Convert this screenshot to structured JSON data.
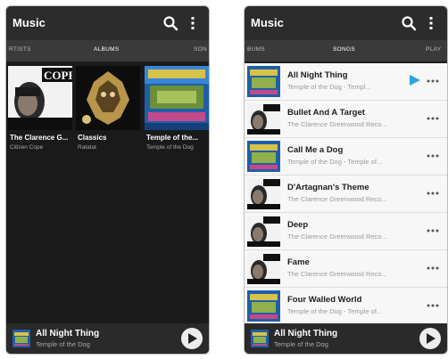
{
  "left": {
    "app_title": "Music",
    "tabs": [
      "RTISTS",
      "ALBUMS",
      "SON"
    ],
    "albums": [
      {
        "title": "The Clarence G...",
        "artist": "Citizen Cope",
        "cover_text": "COPE"
      },
      {
        "title": "Classics",
        "artist": "Ratatat"
      },
      {
        "title": "Temple of the...",
        "artist": "Temple of the Dog"
      }
    ],
    "now_playing": {
      "title": "All Night Thing",
      "artist": "Temple of the Dog"
    }
  },
  "right": {
    "app_title": "Music",
    "tabs": [
      "BUMS",
      "SONGS",
      "PLAY"
    ],
    "songs": [
      {
        "title": "All Night Thing",
        "subtitle": "Temple of the Dog - Templ..."
      },
      {
        "title": "Bullet And A Target",
        "subtitle": "The Clarence Greenwood Reco..."
      },
      {
        "title": "Call Me a Dog",
        "subtitle": "Temple of the Dog - Temple of..."
      },
      {
        "title": "D'Artagnan's Theme",
        "subtitle": "The Clarence Greenwood Reco..."
      },
      {
        "title": "Deep",
        "subtitle": "The Clarence Greenwood Reco..."
      },
      {
        "title": "Fame",
        "subtitle": "The Clarence Greenwood Reco..."
      },
      {
        "title": "Four Walled World",
        "subtitle": "Temple of the Dog - Temple of..."
      }
    ],
    "now_playing": {
      "title": "All Night Thing",
      "artist": "Temple of the Dog"
    }
  },
  "icons": {
    "search": "search-icon",
    "menu": "overflow-menu-icon",
    "play": "play-icon",
    "more": "more-options-icon",
    "now_playing": "playing-indicator-icon"
  },
  "colors": {
    "accent": "#2aa3e0",
    "dark_bg": "#1a1a1a",
    "app_bar": "#2c2c2c",
    "list_bg": "#f4f4f4"
  }
}
